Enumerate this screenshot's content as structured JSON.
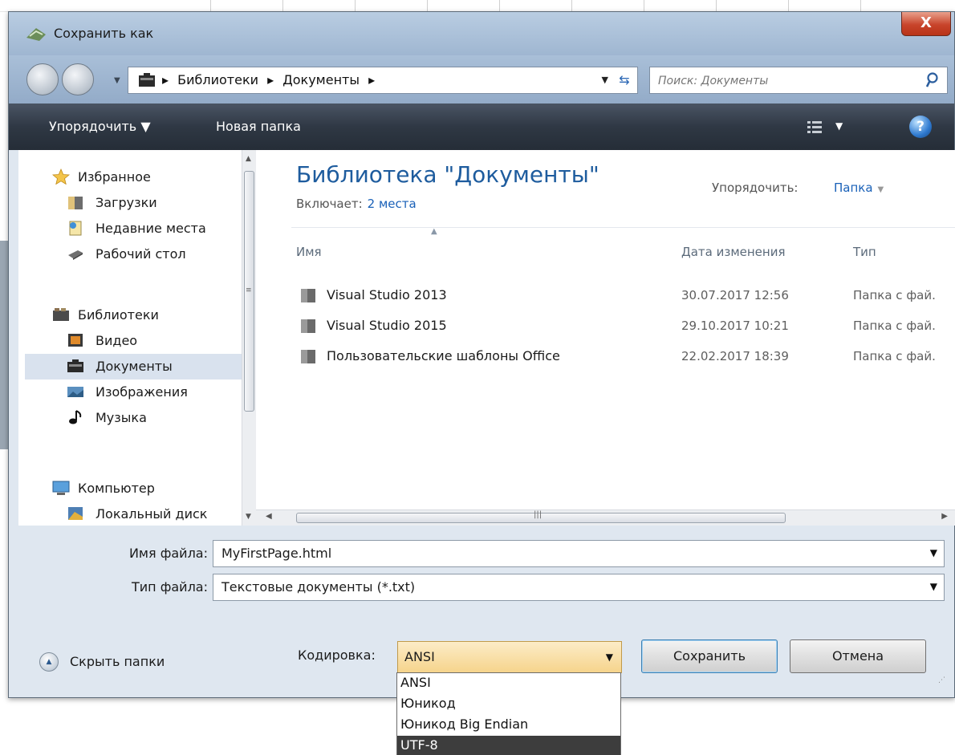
{
  "dialog": {
    "title": "Сохранить как",
    "close_label": "X"
  },
  "address": {
    "crumbs": [
      "Библиотеки",
      "Документы"
    ],
    "sep": "▸"
  },
  "search": {
    "placeholder": "Поиск: Документы"
  },
  "toolbar": {
    "organize_label": "Упорядочить ▼",
    "new_folder_label": "Новая папка",
    "view_caret": "▼",
    "help_label": "?"
  },
  "nav": {
    "favorites": "Избранное",
    "downloads": "Загрузки",
    "recent": "Недавние места",
    "desktop": "Рабочий стол",
    "libraries": "Библиотеки",
    "video": "Видео",
    "documents": "Документы",
    "images": "Изображения",
    "music": "Музыка",
    "computer": "Компьютер",
    "local_disk": "Локальный диск"
  },
  "library": {
    "title": "Библиотека \"Документы\"",
    "includes_label": "Включает:",
    "includes_link": "2 места",
    "arrange_label": "Упорядочить:",
    "arrange_value": "Папка"
  },
  "columns": {
    "name": "Имя",
    "date": "Дата изменения",
    "type": "Тип"
  },
  "files": [
    {
      "name": "Visual Studio 2013",
      "date": "30.07.2017 12:56",
      "type": "Папка с фай."
    },
    {
      "name": "Visual Studio 2015",
      "date": "29.10.2017 10:21",
      "type": "Папка с фай."
    },
    {
      "name": "Пользовательские шаблоны Office",
      "date": "22.02.2017 18:39",
      "type": "Папка с фай."
    }
  ],
  "form": {
    "filename_label": "Имя файла:",
    "filename_value": "MyFirstPage.html",
    "filetype_label": "Тип файла:",
    "filetype_value": "Текстовые документы (*.txt)",
    "hide_folders": "Скрыть папки",
    "encoding_label": "Кодировка:",
    "encoding_value": "ANSI",
    "save": "Сохранить",
    "cancel": "Отмена"
  },
  "encoding_options": [
    "ANSI",
    "Юникод",
    "Юникод Big Endian",
    "UTF-8"
  ],
  "colors": {
    "accent_title": "#1e5c9e",
    "link": "#1a61b8",
    "highlight_option": "#3d3d3d"
  }
}
